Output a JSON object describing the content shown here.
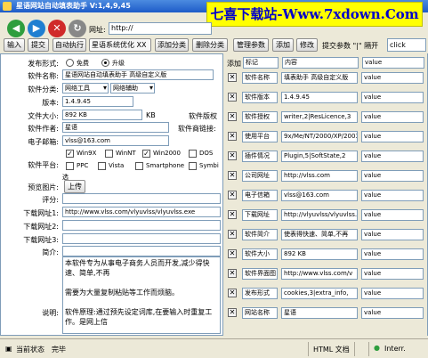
{
  "title": "星语网站自动填表助手 V:1,4,9,45",
  "brand": "七喜下载站-Www.7xdown.Com",
  "address": {
    "label": "网址:",
    "value": "http://"
  },
  "toolbar": {
    "buttons": [
      "输入",
      "提交",
      "自动执行",
      "星语系统优化 XX",
      "添加分类",
      "删除分类",
      "管理参数",
      "添加",
      "修改"
    ],
    "submit_label": "提交参数 \"|\" 隔开",
    "submit_value": "click"
  },
  "form": {
    "release_type": {
      "label": "发布形式:",
      "options": [
        "免费",
        "升级"
      ]
    },
    "name": {
      "label": "软件名称:",
      "value": "星语网站自动填表助手 高级自定义版"
    },
    "category": {
      "label": "软件分类:",
      "values": [
        "网络工具",
        "网络辅助"
      ]
    },
    "version": {
      "label": "版本:",
      "value": "1.4.9.45"
    },
    "size": {
      "label": "文件大小:",
      "value": "892 KB",
      "unit": "KB"
    },
    "copyright": {
      "label": "软件版权"
    },
    "author": {
      "label": "软件作者:",
      "value": "星语"
    },
    "homepage": {
      "label": "软件商链接:"
    },
    "email": {
      "label": "电子邮箱:",
      "value": "vlss@163.com"
    },
    "platform": {
      "label": "软件平台:",
      "options": [
        "Win9X",
        "WinNT",
        "Win2000",
        "DOS",
        "PPC",
        "Vista",
        "Smartphone",
        "Symbi",
        "选"
      ],
      "checked": [
        "Win9X",
        "Win2000"
      ]
    },
    "preview": {
      "label": "预览图片:",
      "button": "上传"
    },
    "rating": {
      "label": "评分:"
    },
    "download1": {
      "label": "下载网址1:",
      "value": "http://www.vlss.com/vlyuvlss/vlyuvlss.exe"
    },
    "download2": {
      "label": "下载网址2:"
    },
    "download3": {
      "label": "下载网址3:"
    },
    "intro": {
      "label": "简介:"
    },
    "description": {
      "label": "说明:",
      "text": "本软件专为从事电子商务人员而开发,减少得快速、简单,不再\n\n需要为大量复制粘贴等工作而烦脑。\n\n软件原理:通过预先设定词库,在要输入时重复工作。是网上信"
    }
  },
  "panel": {
    "header": {
      "add": "添加",
      "col1": "标记",
      "col2": "内容",
      "col3": "value"
    },
    "rows": [
      {
        "key": "软件名称",
        "content": "填表助手 高级自定义版",
        "value": "value"
      },
      {
        "key": "软件版本",
        "content": "1.4.9.45",
        "value": "value"
      },
      {
        "key": "软件授权",
        "content": "writer,2|ResLicence,3",
        "value": "value"
      },
      {
        "key": "使用平台",
        "content": "9x/Me/NT/2000/XP/2003",
        "value": "value"
      },
      {
        "key": "插件情况",
        "content": "Plugin,5|SoftState,2",
        "value": "value"
      },
      {
        "key": "公司网址",
        "content": "http://vlss.com",
        "value": "value"
      },
      {
        "key": "电子信箱",
        "content": "vlss@163.com",
        "value": "value"
      },
      {
        "key": "下载网址",
        "content": "http://vlyuvlss/vlyuvlss.exe",
        "value": "value"
      },
      {
        "key": "软件简介",
        "content": "使表得快速、简单,不再",
        "value": "value"
      },
      {
        "key": "软件大小",
        "content": "892 KB",
        "value": "value"
      },
      {
        "key": "软件界面图",
        "content": "http://www.vlss.com/v",
        "value": "value"
      },
      {
        "key": "发布形式",
        "content": "cookies,3|extra_info,",
        "value": "value"
      },
      {
        "key": "网站名称",
        "content": "星语",
        "value": "value"
      }
    ]
  },
  "status": {
    "left": "当前状态",
    "state": "完毕",
    "doc": "HTML 文档",
    "zone": "Interr."
  },
  "colors": {
    "titlebar": "#1d5bc8",
    "brand_bg": "#ffff00",
    "brand_text": "#0000cc",
    "back_btn": "#2e9e3e",
    "forward_btn": "#1f7fd1",
    "stop_btn": "#d02a2a"
  }
}
